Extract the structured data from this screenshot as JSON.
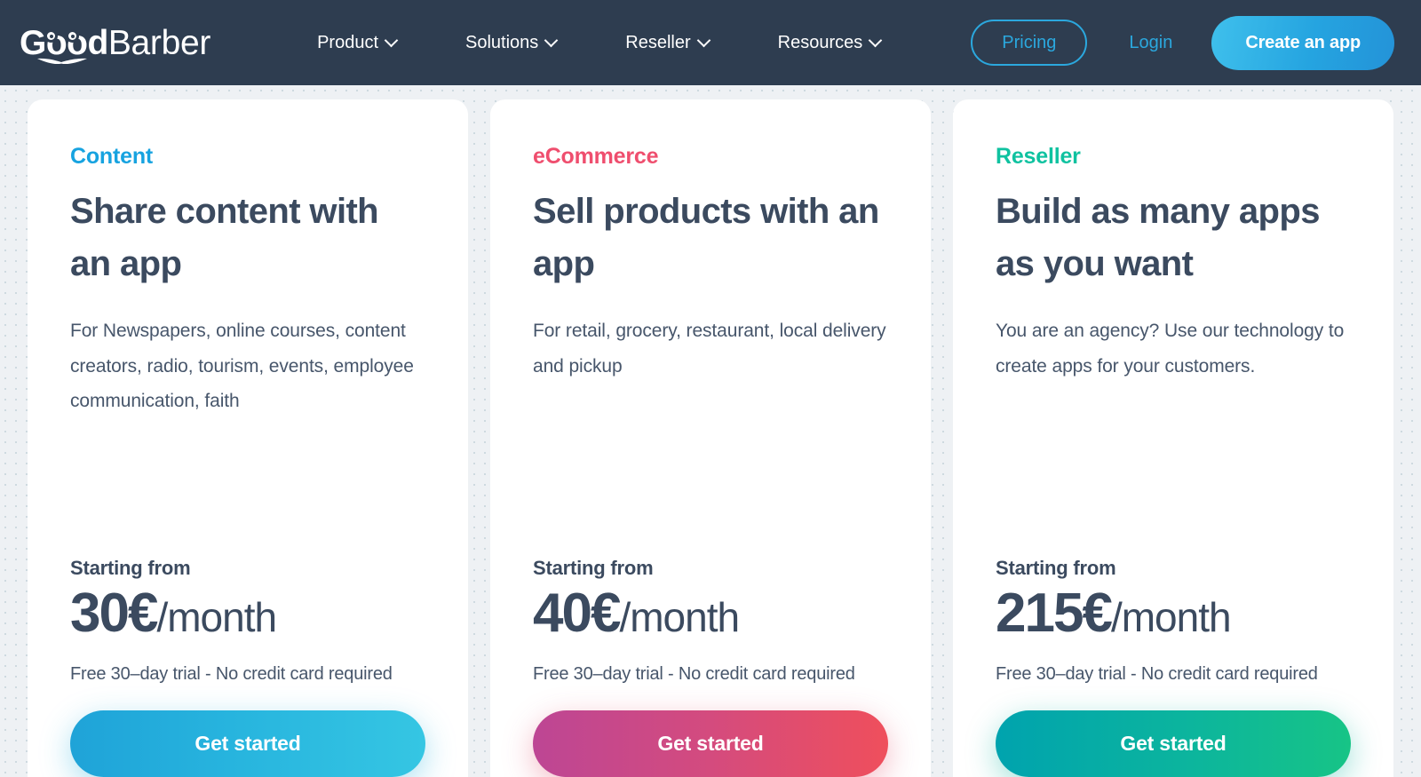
{
  "brand": {
    "name_bold": "Good",
    "name_light": "Barber",
    "accent_blue": "#2ba8de",
    "dark_navy": "#2e3d50",
    "text_navy": "#3b4a5f"
  },
  "header": {
    "nav": [
      {
        "label": "Product",
        "has_dropdown": true
      },
      {
        "label": "Solutions",
        "has_dropdown": true
      },
      {
        "label": "Reseller",
        "has_dropdown": true
      },
      {
        "label": "Resources",
        "has_dropdown": true
      }
    ],
    "pricing_label": "Pricing",
    "login_label": "Login",
    "create_app_label": "Create an app"
  },
  "cards": [
    {
      "kicker": "Content",
      "kicker_color": "#17a3e0",
      "title": "Share content with an app",
      "description": "For Newspapers, online courses, content creators, radio, tourism, events, employee communication, faith",
      "price_label": "Starting from",
      "price_amount": "30€",
      "price_period": "/month",
      "price_note": "Free 30–day trial - No credit card required",
      "cta_label": "Get started"
    },
    {
      "kicker": "eCommerce",
      "kicker_color": "#ef4e6e",
      "title": "Sell products with an app",
      "description": "For retail, grocery, restaurant, local delivery and pickup",
      "price_label": "Starting from",
      "price_amount": "40€",
      "price_period": "/month",
      "price_note": "Free 30–day trial - No credit card required",
      "cta_label": "Get started"
    },
    {
      "kicker": "Reseller",
      "kicker_color": "#0fc2a0",
      "title": "Build as many apps as you want",
      "description": "You are an agency? Use our technology to create apps for your customers.",
      "price_label": "Starting from",
      "price_amount": "215€",
      "price_period": "/month",
      "price_note": "Free 30–day trial - No credit card required",
      "cta_label": "Get started"
    }
  ]
}
